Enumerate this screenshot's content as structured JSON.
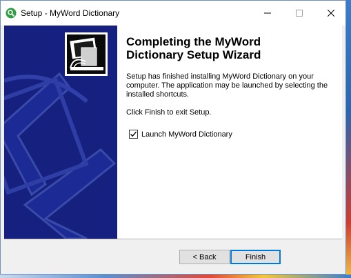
{
  "window": {
    "title": "Setup - MyWord Dictionary",
    "controls": [
      "minimize-icon",
      "maximize-icon",
      "close-icon"
    ]
  },
  "wizard": {
    "heading_line1": "Completing the MyWord",
    "heading_line2": "Dictionary Setup Wizard",
    "description": "Setup has finished installing MyWord Dictionary on your computer. The application may be launched by selecting the installed shortcuts.",
    "finish_note": "Click Finish to exit Setup.",
    "launch_checkbox": {
      "label": "Launch MyWord Dictionary",
      "checked": true
    }
  },
  "buttons": {
    "back": "< Back",
    "finish": "Finish"
  },
  "colors": {
    "banner": "#16217f",
    "accent": "#0078d7",
    "app_icon": "#2f9e44"
  }
}
